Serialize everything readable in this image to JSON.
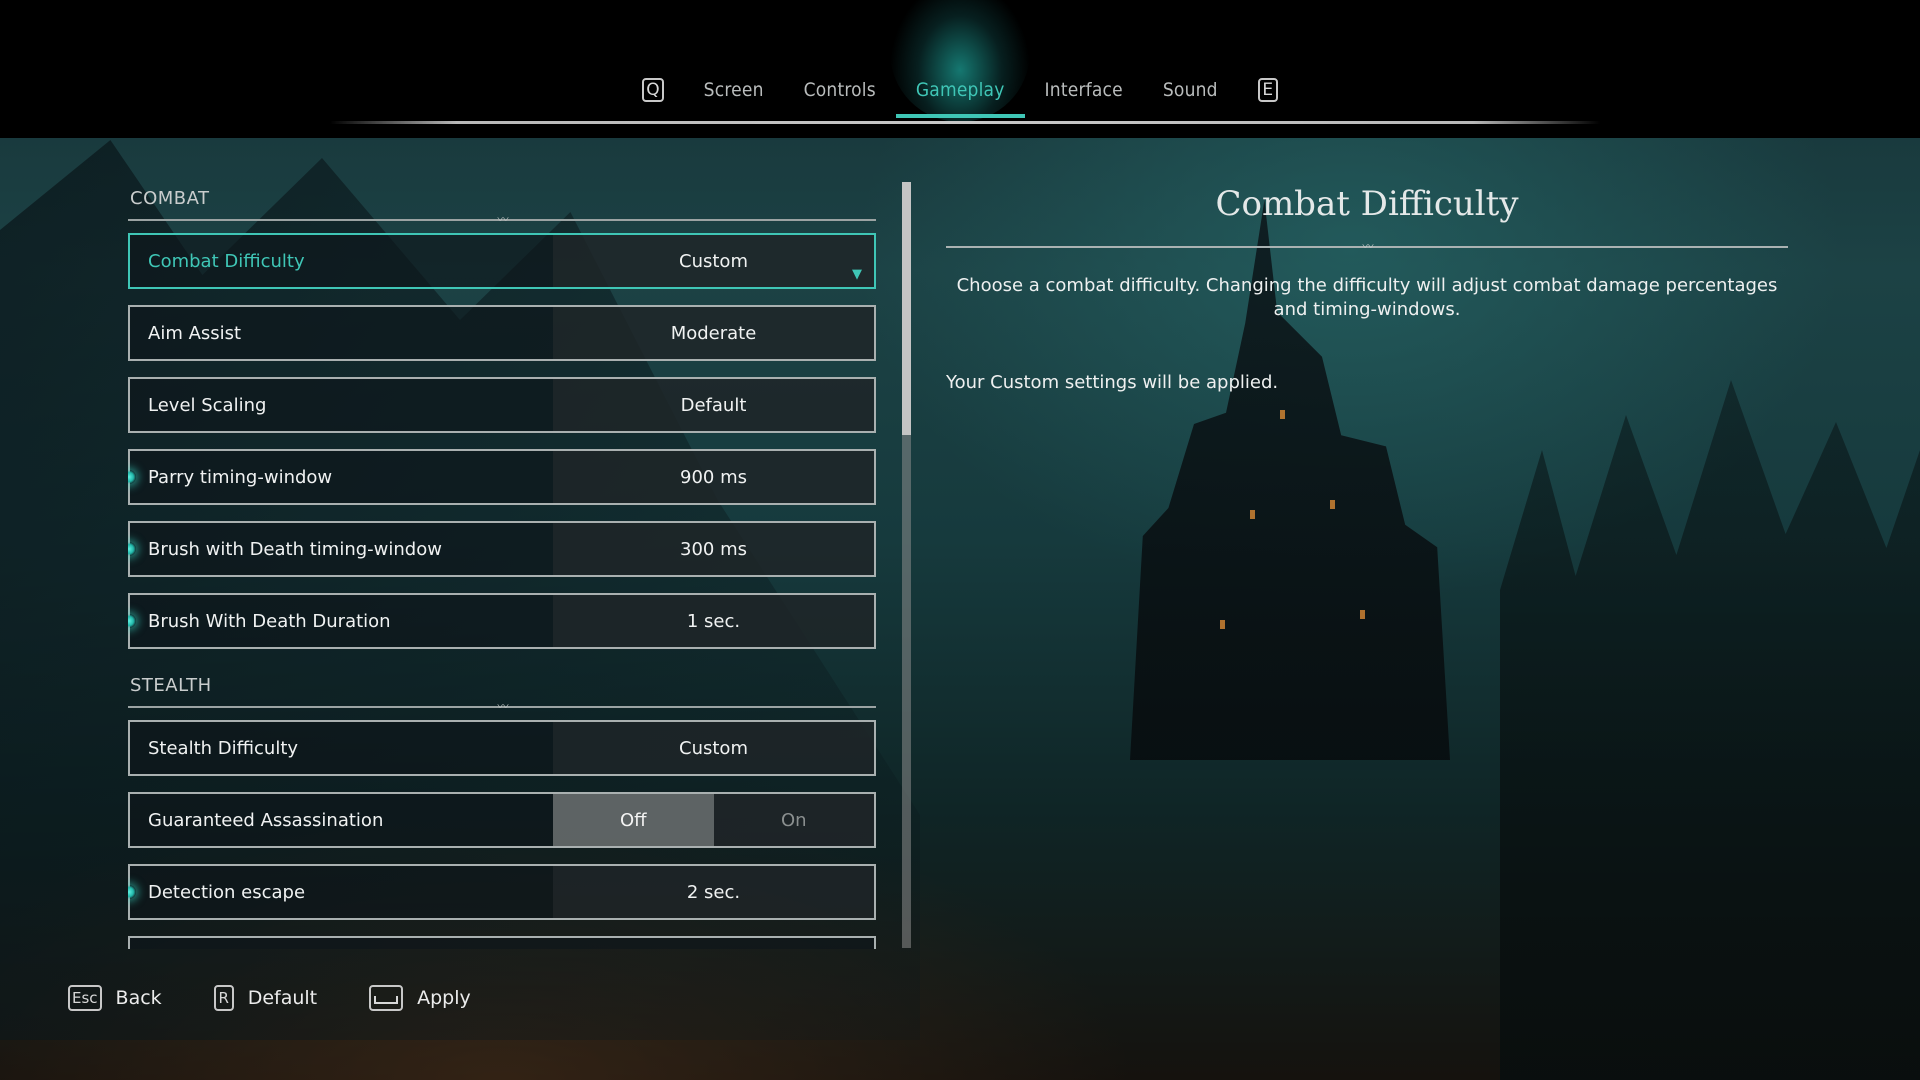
{
  "tabs": {
    "prev_key": "Q",
    "next_key": "E",
    "items": [
      {
        "label": "Screen",
        "active": false
      },
      {
        "label": "Controls",
        "active": false
      },
      {
        "label": "Gameplay",
        "active": true
      },
      {
        "label": "Interface",
        "active": false
      },
      {
        "label": "Sound",
        "active": false
      }
    ]
  },
  "sections": {
    "combat": {
      "title": "COMBAT",
      "rows": [
        {
          "label": "Combat Difficulty",
          "value": "Custom",
          "selected": true,
          "modified": false
        },
        {
          "label": "Aim Assist",
          "value": "Moderate",
          "modified": false
        },
        {
          "label": "Level Scaling",
          "value": "Default",
          "modified": false
        },
        {
          "label": "Parry timing-window",
          "value": "900 ms",
          "modified": true
        },
        {
          "label": "Brush with Death timing-window",
          "value": "300 ms",
          "modified": true
        },
        {
          "label": "Brush With Death Duration",
          "value": "1 sec.",
          "modified": true
        }
      ]
    },
    "stealth": {
      "title": "STEALTH",
      "rows": [
        {
          "label": "Stealth Difficulty",
          "value": "Custom",
          "modified": false
        },
        {
          "label": "Guaranteed Assassination",
          "options": [
            "Off",
            "On"
          ],
          "selected": "Off",
          "modified": false
        },
        {
          "label": "Detection escape",
          "value": "2 sec.",
          "modified": true
        }
      ]
    }
  },
  "scroll": {
    "position_fraction": 0.0,
    "visible_fraction": 0.33
  },
  "detail": {
    "title": "Combat Difficulty",
    "description": "Choose a combat difficulty. Changing the difficulty will adjust combat damage percentages and timing-windows.",
    "note": "Your Custom settings will be applied."
  },
  "footer": {
    "back": {
      "key": "Esc",
      "label": "Back"
    },
    "default": {
      "key": "R",
      "label": "Default"
    },
    "apply": {
      "key": "Space",
      "label": "Apply"
    }
  },
  "colors": {
    "accent": "#3fc6b6",
    "text": "#f0f2f2",
    "border": "#a9b0b0"
  }
}
